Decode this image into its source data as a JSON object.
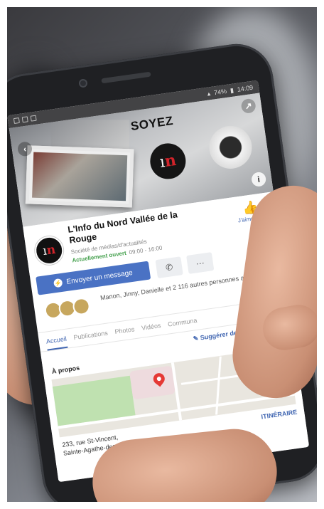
{
  "status": {
    "battery": "74%",
    "time": "14:09"
  },
  "cover": {
    "slogan": "SOYEZ",
    "logo_text": "ı",
    "logo_accent": "n"
  },
  "page": {
    "name": "L'Info du Nord Vallée de la Rouge",
    "category": "Société de médias/d'actualités",
    "open_status": "Actuellement ouvert",
    "hours": "09:00 - 16:00",
    "like_label": "J'aime déjà"
  },
  "actions": {
    "message_label": "Envoyer un message",
    "phone_icon": "phone-icon",
    "more_label": "···"
  },
  "friends": {
    "text": "Manon, Jinny, Danielle et 2 116 autres personnes aiment"
  },
  "tabs": [
    "Accueil",
    "Publications",
    "Photos",
    "Vidéos",
    "Communa"
  ],
  "about": {
    "suggest_label": "Suggérer des modifications",
    "title": "À propos",
    "address_line1": "233, rue St-Vincent,",
    "address_line2": "Sainte-Agathe-des-Monts J8C 2B8",
    "route_label": "ITINÉRAIRE"
  },
  "colors": {
    "brand": "#4267b2",
    "accent": "#d2232a",
    "open": "#44a04d"
  }
}
